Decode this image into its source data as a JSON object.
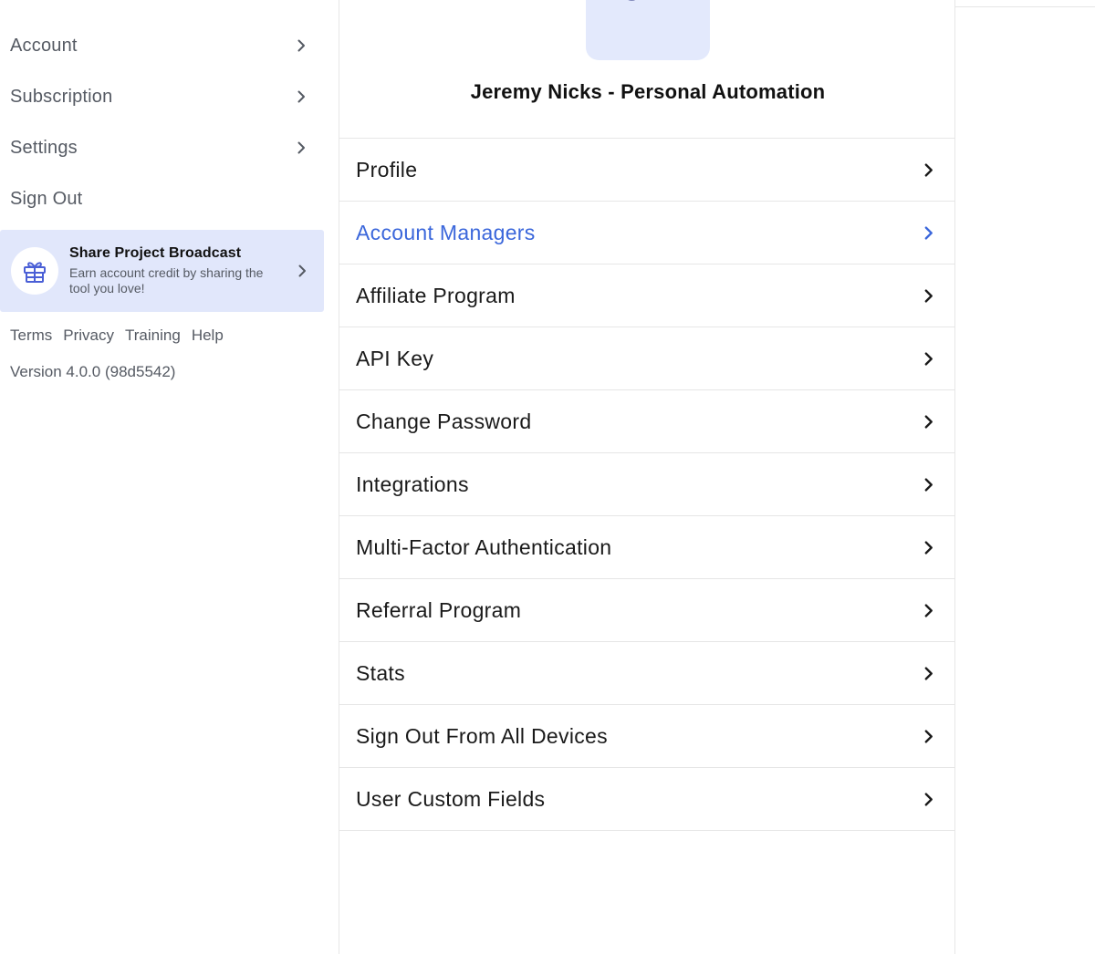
{
  "sidebar": {
    "items": [
      {
        "label": "Account",
        "has_chevron": true
      },
      {
        "label": "Subscription",
        "has_chevron": true
      },
      {
        "label": "Settings",
        "has_chevron": true
      },
      {
        "label": "Sign Out",
        "has_chevron": false
      }
    ],
    "share": {
      "icon": "gift-icon",
      "title": "Share Project Broadcast",
      "subtitle": "Earn account credit by sharing the tool you love!"
    },
    "footer_links": [
      "Terms",
      "Privacy",
      "Training",
      "Help"
    ],
    "version": "Version 4.0.0 (98d5542)"
  },
  "profile": {
    "initials": "JP",
    "org_name": "Jeremy Nicks - Personal Automation"
  },
  "menu": {
    "items": [
      {
        "label": "Profile"
      },
      {
        "label": "Account Managers",
        "active": true
      },
      {
        "label": "Affiliate Program"
      },
      {
        "label": "API Key"
      },
      {
        "label": "Change Password"
      },
      {
        "label": "Integrations"
      },
      {
        "label": "Multi-Factor Authentication"
      },
      {
        "label": "Referral Program"
      },
      {
        "label": "Stats"
      },
      {
        "label": "Sign Out From All Devices"
      },
      {
        "label": "User Custom Fields"
      }
    ]
  },
  "colors": {
    "accent": "#3b67db",
    "avatar_bg": "#e3e9fc",
    "avatar_text": "#202a78",
    "share_bg": "#e1e7fb",
    "muted_text": "#555a63"
  }
}
